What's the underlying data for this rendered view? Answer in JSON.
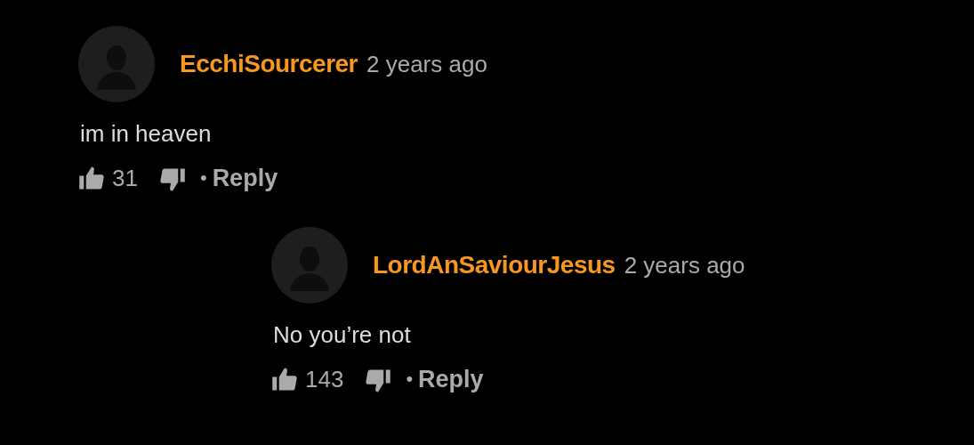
{
  "comments": [
    {
      "author": "EcchiSourcerer",
      "time": "2 years ago",
      "text": "im in heaven",
      "likes": "31",
      "separator": "•",
      "reply_link": "Reply",
      "replies": [
        {
          "author": "LordAnSaviourJesus",
          "time": "2 years ago",
          "text": "No you’re not",
          "likes": "143",
          "separator": "•",
          "reply_link": "Reply"
        }
      ]
    }
  ]
}
